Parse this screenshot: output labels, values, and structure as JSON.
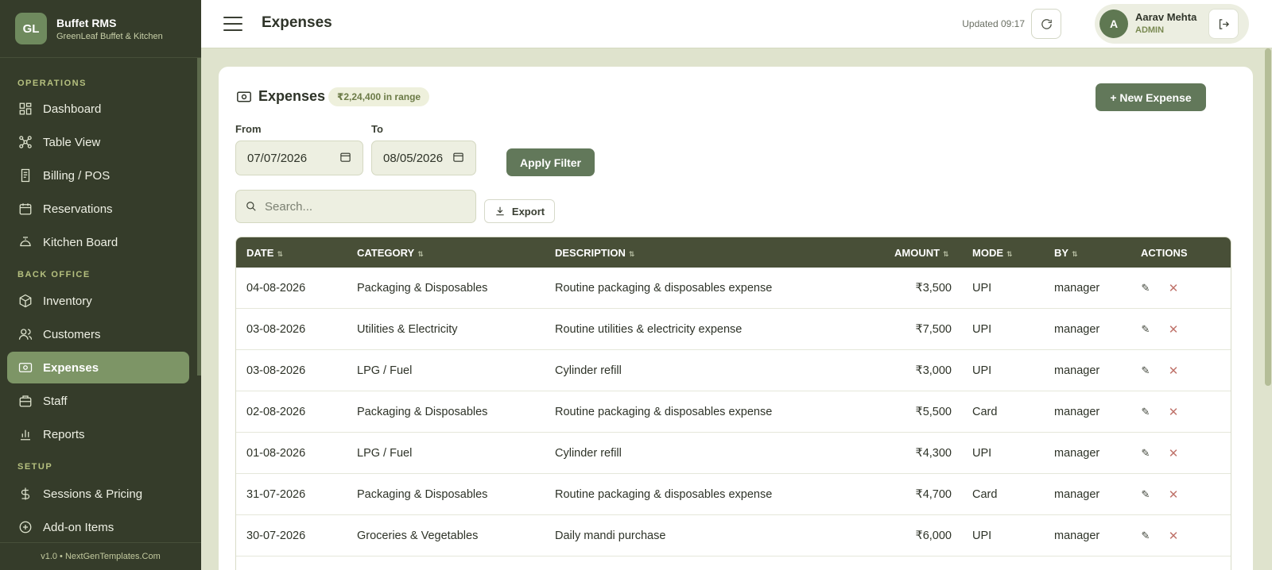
{
  "brand": {
    "logo": "GL",
    "name": "Buffet RMS",
    "subtitle": "GreenLeaf Buffet & Kitchen"
  },
  "sidebar": {
    "sections": [
      {
        "title": "OPERATIONS"
      },
      {
        "title": "BACK OFFICE"
      },
      {
        "title": "SETUP"
      }
    ],
    "items": [
      {
        "label": "Dashboard",
        "icon": "grid-icon"
      },
      {
        "label": "Table View",
        "icon": "nodes-icon"
      },
      {
        "label": "Billing / POS",
        "icon": "receipt-icon"
      },
      {
        "label": "Reservations",
        "icon": "calendar-icon"
      },
      {
        "label": "Kitchen Board",
        "icon": "cloche-icon"
      },
      {
        "label": "Inventory",
        "icon": "box-icon"
      },
      {
        "label": "Customers",
        "icon": "users-icon"
      },
      {
        "label": "Expenses",
        "icon": "wallet-icon",
        "active": true
      },
      {
        "label": "Staff",
        "icon": "briefcase-icon"
      },
      {
        "label": "Reports",
        "icon": "bar-chart-icon"
      },
      {
        "label": "Sessions & Pricing",
        "icon": "dollar-icon"
      },
      {
        "label": "Add-on Items",
        "icon": "plus-circle-icon"
      }
    ],
    "footer": "v1.0 • NextGenTemplates.Com"
  },
  "header": {
    "title": "Expenses",
    "updated": "Updated 09:17",
    "user": {
      "initial": "A",
      "name": "Aarav Mehta",
      "role": "ADMIN"
    }
  },
  "card": {
    "title": "Expenses",
    "range_badge": "₹2,24,400 in range",
    "new_button": "+ New Expense",
    "from_label": "From",
    "from_value": "07/07/2026",
    "to_label": "To",
    "to_value": "08/05/2026",
    "apply_button": "Apply Filter",
    "search_placeholder": "Search...",
    "export_button": "Export"
  },
  "table": {
    "columns": [
      "DATE",
      "CATEGORY",
      "DESCRIPTION",
      "AMOUNT",
      "MODE",
      "BY",
      "ACTIONS"
    ],
    "rows": [
      {
        "date": "04-08-2026",
        "category": "Packaging & Disposables",
        "description": "Routine packaging & disposables expense",
        "amount": "₹3,500",
        "mode": "UPI",
        "by": "manager"
      },
      {
        "date": "03-08-2026",
        "category": "Utilities & Electricity",
        "description": "Routine utilities & electricity expense",
        "amount": "₹7,500",
        "mode": "UPI",
        "by": "manager"
      },
      {
        "date": "03-08-2026",
        "category": "LPG / Fuel",
        "description": "Cylinder refill",
        "amount": "₹3,000",
        "mode": "UPI",
        "by": "manager"
      },
      {
        "date": "02-08-2026",
        "category": "Packaging & Disposables",
        "description": "Routine packaging & disposables expense",
        "amount": "₹5,500",
        "mode": "Card",
        "by": "manager"
      },
      {
        "date": "01-08-2026",
        "category": "LPG / Fuel",
        "description": "Cylinder refill",
        "amount": "₹4,300",
        "mode": "UPI",
        "by": "manager"
      },
      {
        "date": "31-07-2026",
        "category": "Packaging & Disposables",
        "description": "Routine packaging & disposables expense",
        "amount": "₹4,700",
        "mode": "Card",
        "by": "manager"
      },
      {
        "date": "30-07-2026",
        "category": "Groceries & Vegetables",
        "description": "Daily mandi purchase",
        "amount": "₹6,000",
        "mode": "UPI",
        "by": "manager"
      }
    ]
  }
}
